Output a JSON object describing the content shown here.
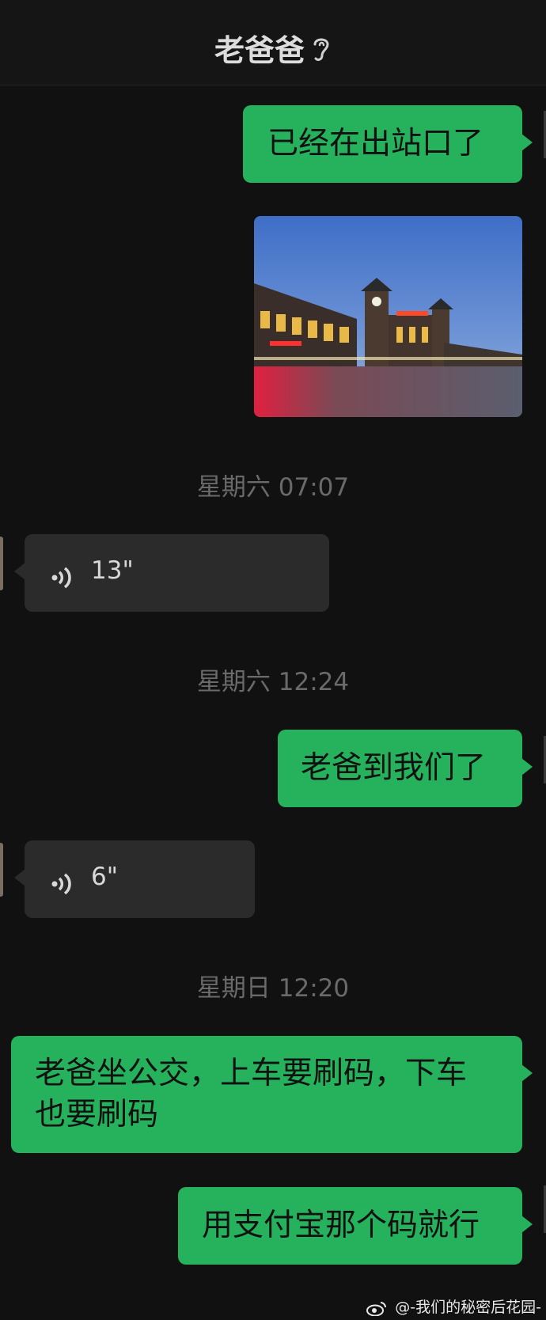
{
  "header": {
    "title": "老爸爸",
    "icon": "ear-icon"
  },
  "messages": [
    {
      "type": "text",
      "text": "已经在出站口了"
    },
    {
      "type": "image",
      "alt": ""
    },
    {
      "type": "time",
      "text": "星期六 07:07"
    },
    {
      "type": "voice",
      "duration": "13\""
    },
    {
      "type": "time",
      "text": "星期六 12:24"
    },
    {
      "type": "text",
      "text": "老爸到我们了"
    },
    {
      "type": "voice",
      "duration": "6\""
    },
    {
      "type": "time",
      "text": "星期日 12:20"
    },
    {
      "type": "text",
      "lines": [
        "老爸坐公交，上车要刷码，下车",
        "也要刷码"
      ]
    },
    {
      "type": "text",
      "text": "用支付宝那个码就行"
    }
  ],
  "watermark": {
    "text": "@-我们的秘密后花园-",
    "icon": "weibo-icon"
  },
  "colors": {
    "sent_bubble": "#26b15c",
    "voice_bubble": "#2b2b2b",
    "background": "#111111"
  }
}
